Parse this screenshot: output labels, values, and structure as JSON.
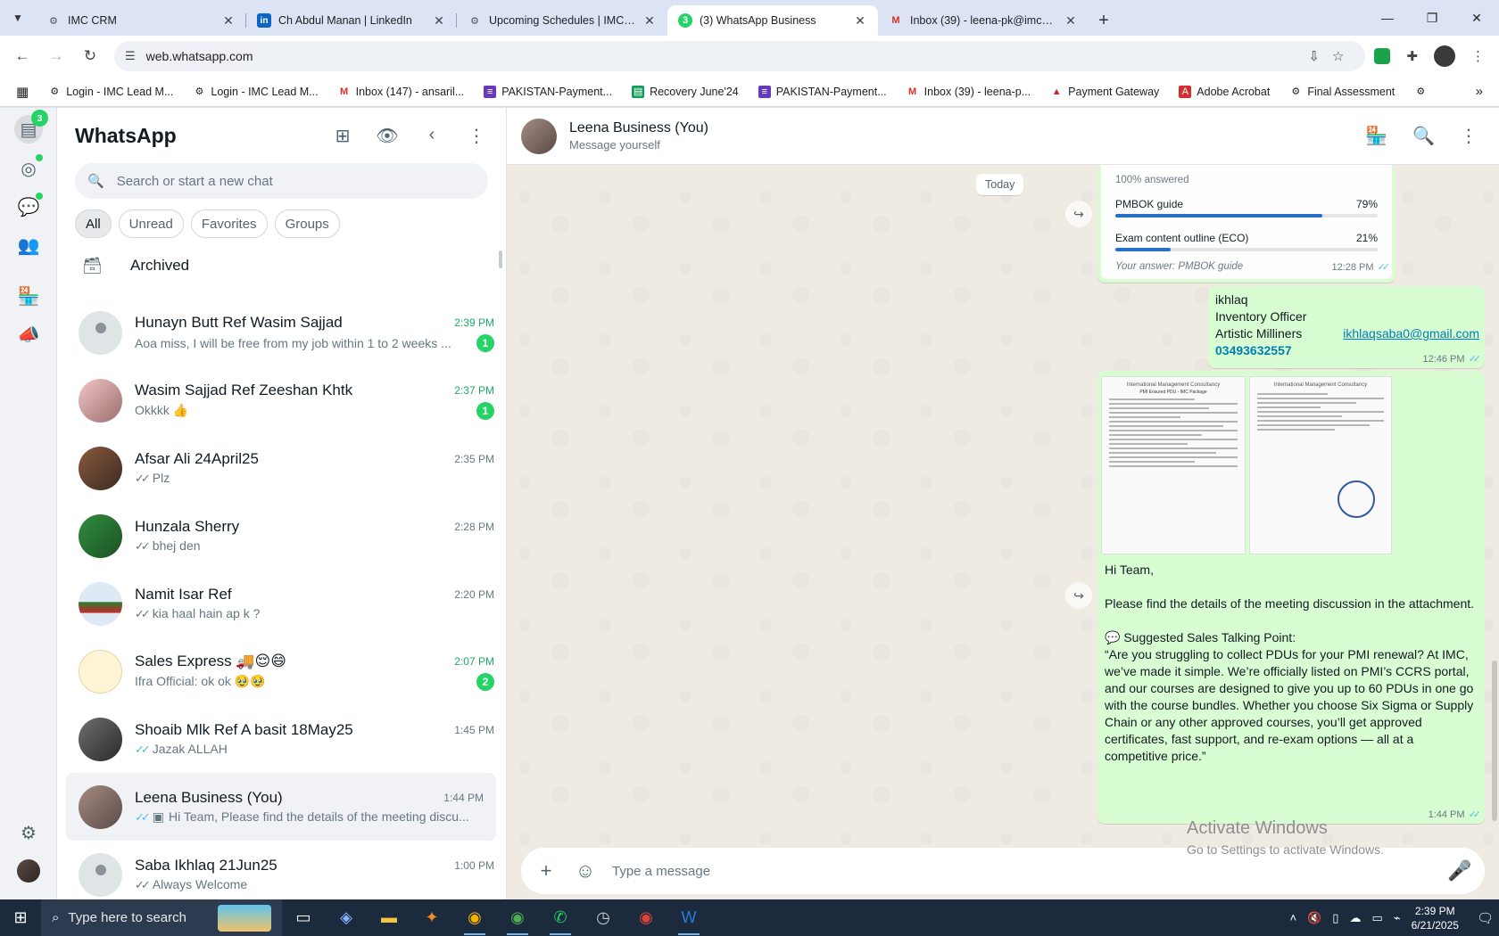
{
  "browser": {
    "tabs": [
      {
        "title": "IMC CRM",
        "icon": "imc-icon",
        "active": false
      },
      {
        "title": "Ch Abdul Manan | LinkedIn",
        "icon": "linkedin-icon",
        "active": false
      },
      {
        "title": "Upcoming Schedules | IMC Certif",
        "icon": "imc-icon",
        "active": false
      },
      {
        "title": "(3) WhatsApp Business",
        "icon": "whatsapp-icon",
        "active": true
      },
      {
        "title": "Inbox (39) - leena-pk@imccertif",
        "icon": "gmail-icon",
        "active": false
      }
    ],
    "url": "web.whatsapp.com",
    "bookmarks": [
      {
        "label": "Login - IMC Lead M...",
        "icon": "imc-icon"
      },
      {
        "label": "Login - IMC Lead M...",
        "icon": "imc-icon"
      },
      {
        "label": "Inbox (147) - ansaril...",
        "icon": "gmail-icon"
      },
      {
        "label": "PAKISTAN-Payment...",
        "icon": "forms-icon"
      },
      {
        "label": "Recovery June'24",
        "icon": "sheets-icon"
      },
      {
        "label": "PAKISTAN-Payment...",
        "icon": "forms-icon"
      },
      {
        "label": "Inbox (39) - leena-p...",
        "icon": "gmail-icon"
      },
      {
        "label": "Payment Gateway",
        "icon": "gateway-icon"
      },
      {
        "label": "Adobe Acrobat",
        "icon": "acrobat-icon"
      },
      {
        "label": "Final Assessment",
        "icon": "imc-icon"
      }
    ]
  },
  "rail": {
    "chats_badge": "3"
  },
  "sidebar": {
    "title": "WhatsApp",
    "search_placeholder": "Search or start a new chat",
    "filters": [
      "All",
      "Unread",
      "Favorites",
      "Groups"
    ],
    "archived_label": "Archived",
    "chats": [
      {
        "name": "Hunayn Butt Ref Wasim Sajjad",
        "time": "2:39 PM",
        "preview": "Aoa miss, I will be free from my job within 1 to 2 weeks ...",
        "unread": "1",
        "ticks": "",
        "avatar": "default"
      },
      {
        "name": "Wasim Sajjad Ref Zeeshan Khtk",
        "time": "2:37 PM",
        "preview": "Okkkk 👍",
        "unread": "1",
        "ticks": "",
        "avatar": "photo-pink"
      },
      {
        "name": "Afsar Ali 24April25",
        "time": "2:35 PM",
        "preview": "Plz",
        "unread": "",
        "ticks": "grey",
        "avatar": "photo-warm"
      },
      {
        "name": "Hunzala Sherry",
        "time": "2:28 PM",
        "preview": "bhej den",
        "unread": "",
        "ticks": "grey",
        "avatar": "photo-green"
      },
      {
        "name": "Namit Isar Ref",
        "time": "2:20 PM",
        "preview": "kia haal hain ap k ?",
        "unread": "",
        "ticks": "grey",
        "avatar": "photo-flag"
      },
      {
        "name": "Sales Express 🚚😌😄",
        "time": "2:07 PM",
        "preview": "Ifra Official: ok ok 🥹🥹",
        "unread": "2",
        "ticks": "",
        "avatar": "photo-sales"
      },
      {
        "name": "Shoaib Mlk Ref A basit 18May25",
        "time": "1:45 PM",
        "preview": "Jazak ALLAH",
        "unread": "",
        "ticks": "blue",
        "avatar": "photo-dark"
      },
      {
        "name": "Leena Business (You)",
        "time": "1:44 PM",
        "preview": "Hi Team, Please find the details of the meeting discu...",
        "unread": "",
        "ticks": "blue",
        "avatar": "photo-leena",
        "selected": true,
        "media": true
      },
      {
        "name": "Saba Ikhlaq 21Jun25",
        "time": "1:00 PM",
        "preview": "Always Welcome",
        "unread": "",
        "ticks": "grey",
        "avatar": "default"
      }
    ]
  },
  "conversation": {
    "name": "Leena Business (You)",
    "subtitle": "Message yourself",
    "day": "Today",
    "poll": {
      "answered": "100% answered",
      "options": [
        {
          "label": "PMBOK guide",
          "percent": 79
        },
        {
          "label": "Exam content outline (ECO)",
          "percent": 21
        }
      ],
      "your_answer": "Your answer: PMBOK guide",
      "time": "12:28 PM"
    },
    "contact": {
      "lines": [
        "ikhlaq",
        "Inventory Officer",
        "Artistic Milliners"
      ],
      "email": "ikhlaqsaba0@gmail.com",
      "phone": "03493632557",
      "time": "12:46 PM"
    },
    "doc_header": "International Management Consultancy",
    "doc_title": "PMI Ensured PDU - IMC Package",
    "message": {
      "greeting": "Hi Team,",
      "line1": "Please find the details of the meeting discussion in the attachment.",
      "heading": "💬 Suggested Sales Talking Point:",
      "quote": "“Are you struggling to collect PDUs for your PMI renewal? At IMC, we’ve made it simple. We’re officially listed on PMI’s CCRS portal, and our courses are designed to give you up to 60 PDUs in one go with the course bundles. Whether you choose Six Sigma or Supply Chain or any other approved courses, you’ll get approved certificates, fast support, and re-exam options — all at a competitive price.”",
      "time": "1:44 PM"
    },
    "composer_placeholder": "Type a message",
    "watermark_title": "Activate Windows",
    "watermark_sub": "Go to Settings to activate Windows."
  },
  "taskbar": {
    "search_placeholder": "Type here to search",
    "time": "2:39 PM",
    "date": "6/21/2025"
  }
}
